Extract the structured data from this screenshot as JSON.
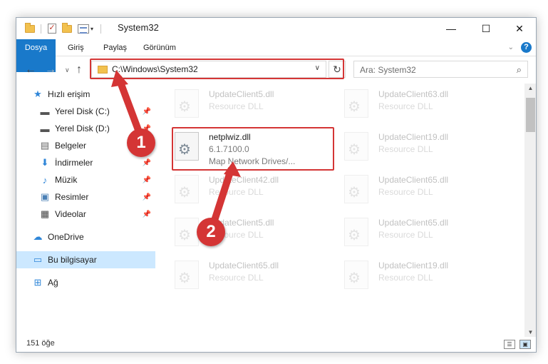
{
  "window": {
    "title": "System32"
  },
  "quick_access": {
    "dropdown": "▾"
  },
  "title_buttons": {
    "minimize": "—",
    "maximize": "☐",
    "close": "✕"
  },
  "ribbon": {
    "tabs": [
      "Dosya",
      "Giriş",
      "Paylaş",
      "Görünüm"
    ],
    "help": "?"
  },
  "address": {
    "path": "C:\\Windows\\System32",
    "search_placeholder": "Ara: System32"
  },
  "sidebar": {
    "items": [
      {
        "label": "Hızlı erişim",
        "icon": "star-icon",
        "pinned": false
      },
      {
        "label": "Yerel Disk (C:)",
        "icon": "drive-icon",
        "pinned": true
      },
      {
        "label": "Yerel Disk (D:)",
        "icon": "drive-icon",
        "pinned": true
      },
      {
        "label": "Belgeler",
        "icon": "document-icon",
        "pinned": true
      },
      {
        "label": "İndirmeler",
        "icon": "download-icon",
        "pinned": true
      },
      {
        "label": "Müzik",
        "icon": "music-icon",
        "pinned": true
      },
      {
        "label": "Resimler",
        "icon": "pictures-icon",
        "pinned": true
      },
      {
        "label": "Videolar",
        "icon": "video-icon",
        "pinned": true
      },
      {
        "label": "OneDrive",
        "icon": "cloud-icon",
        "pinned": false
      },
      {
        "label": "Bu bilgisayar",
        "icon": "computer-icon",
        "pinned": false,
        "selected": true
      },
      {
        "label": "Ağ",
        "icon": "network-icon",
        "pinned": false
      }
    ]
  },
  "files": [
    {
      "name": "UpdateClient5.dll",
      "desc": "Resource DLL",
      "faded": true
    },
    {
      "name": "UpdateClient63.dll",
      "desc": "Resource DLL",
      "faded": true
    },
    {
      "name": "netplwiz.dll",
      "version": "6.1.7100.0",
      "desc": "Map Network Drives/...",
      "faded": false
    },
    {
      "name": "UpdateClient19.dll",
      "desc": "Resource DLL",
      "faded": true
    },
    {
      "name": "UpdateClient42.dll",
      "desc": "Resource DLL",
      "faded": true
    },
    {
      "name": "UpdateClient65.dll",
      "desc": "Resource DLL",
      "faded": true
    },
    {
      "name": "UpdateClient5.dll",
      "desc": "Resource DLL",
      "faded": true
    },
    {
      "name": "UpdateClient65.dll",
      "desc": "Resource DLL",
      "faded": true
    },
    {
      "name": "UpdateClient65.dll",
      "desc": "Resource DLL",
      "faded": true
    },
    {
      "name": "UpdateClient19.dll",
      "desc": "Resource DLL",
      "faded": true
    }
  ],
  "status": {
    "count": "151 öğe"
  },
  "callouts": {
    "step1": "1",
    "step2": "2"
  },
  "colors": {
    "accent": "#1979ca",
    "highlight": "#d43535",
    "selected": "#cce8ff"
  }
}
